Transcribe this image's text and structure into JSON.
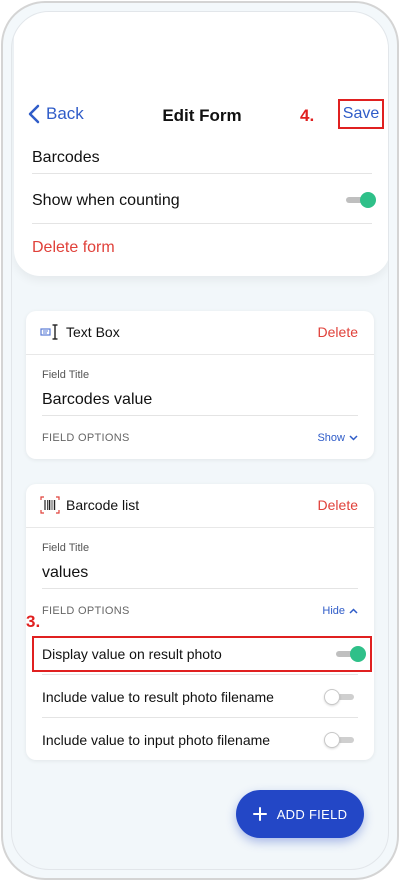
{
  "nav": {
    "back_label": "Back",
    "title": "Edit Form",
    "save_label": "Save"
  },
  "annotations": {
    "step_save": "4.",
    "step_display": "3.",
    "highlight_color": "#e02020"
  },
  "form": {
    "name": "Barcodes",
    "show_when_counting_label": "Show when counting",
    "show_when_counting": true,
    "delete_label": "Delete form"
  },
  "fields": [
    {
      "type_label": "Text Box",
      "icon": "text-box-icon",
      "delete_label": "Delete",
      "title_label": "Field Title",
      "title_value": "Barcodes value",
      "options_label": "FIELD OPTIONS",
      "options_toggle": "Show",
      "options_expanded": false
    },
    {
      "type_label": "Barcode list",
      "icon": "barcode-icon",
      "delete_label": "Delete",
      "title_label": "Field Title",
      "title_value": "values",
      "options_label": "FIELD OPTIONS",
      "options_toggle": "Hide",
      "options_expanded": true,
      "options": [
        {
          "label": "Display value on result photo",
          "on": true
        },
        {
          "label": "Include value to result photo filename",
          "on": false
        },
        {
          "label": "Include value to input photo filename",
          "on": false
        }
      ]
    }
  ],
  "fab": {
    "label": "ADD FIELD"
  },
  "colors": {
    "accent": "#2f5cc8",
    "fab": "#2347c6",
    "danger": "#e0413a",
    "toggle_on": "#2fc089",
    "background": "#f2f7fa"
  }
}
